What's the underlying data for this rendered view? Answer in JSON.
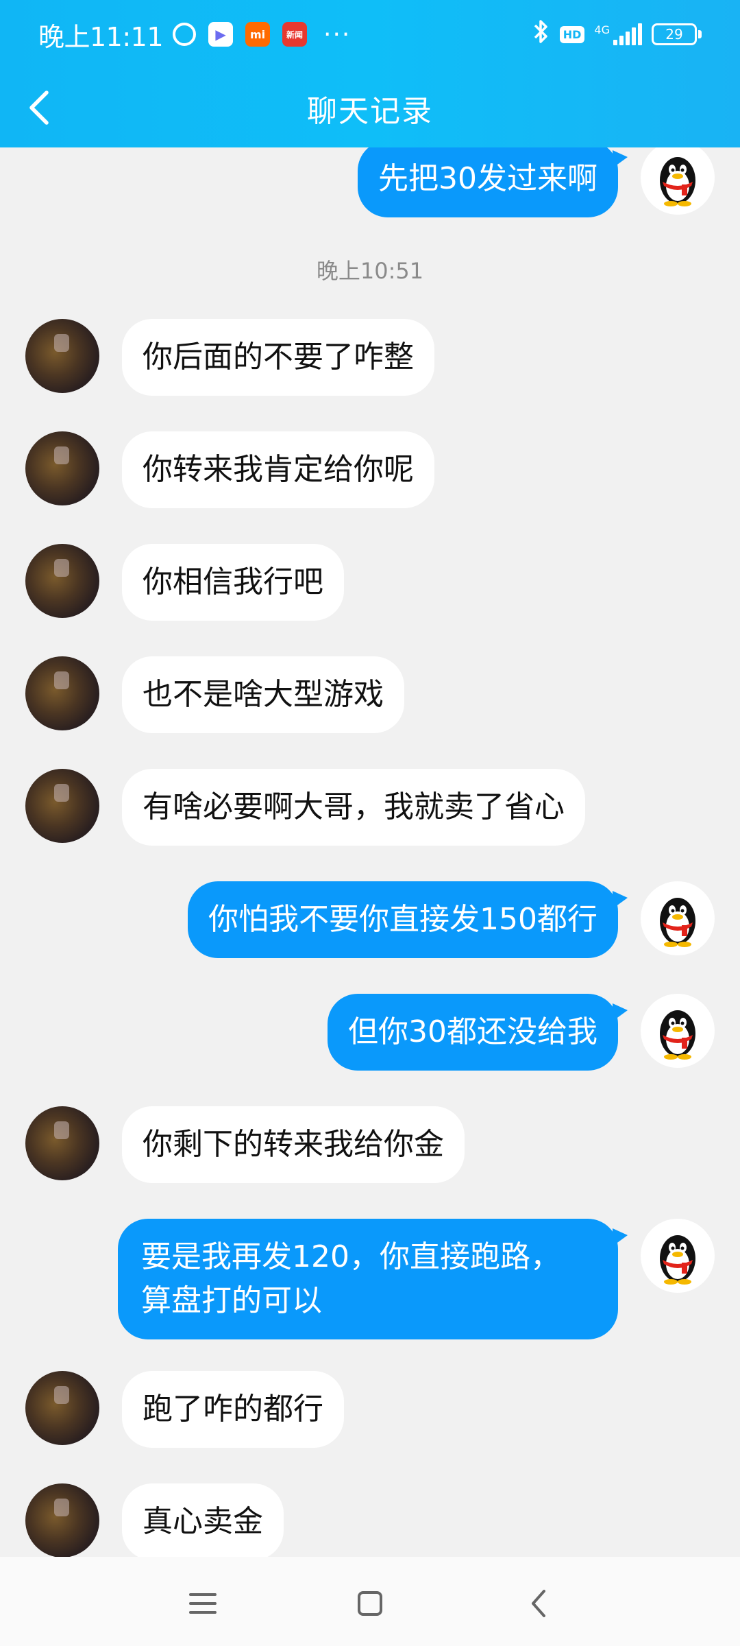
{
  "status_bar": {
    "time": "晚上11:11",
    "mi_icon_label": "mi",
    "news_icon_label": "新闻",
    "hd_label": "HD",
    "network_label": "4G",
    "battery_level": "29"
  },
  "header": {
    "title": "聊天记录"
  },
  "messages": [
    {
      "side": "out",
      "text": "先把30发过来啊"
    },
    {
      "side": "time",
      "text": "晚上10:51"
    },
    {
      "side": "in",
      "text": "你后面的不要了咋整"
    },
    {
      "side": "in",
      "text": "你转来我肯定给你呢"
    },
    {
      "side": "in",
      "text": "你相信我行吧"
    },
    {
      "side": "in",
      "text": "也不是啥大型游戏"
    },
    {
      "side": "in",
      "text": "有啥必要啊大哥，我就卖了省心"
    },
    {
      "side": "out",
      "text": "你怕我不要你直接发150都行"
    },
    {
      "side": "out",
      "text": "但你30都还没给我"
    },
    {
      "side": "in",
      "text": "你剩下的转来我给你金"
    },
    {
      "side": "out",
      "text_line1": "要是我再发120，你直接跑路，",
      "text_line2": "算盘打的可以"
    },
    {
      "side": "in",
      "text": "跑了咋的都行"
    },
    {
      "side": "in",
      "text": "真心卖金"
    }
  ],
  "colors": {
    "header_bg": "#10b6f5",
    "outgoing_bubble": "#0a99fb",
    "incoming_bubble": "#ffffff",
    "chat_bg": "#f1f1f1"
  }
}
